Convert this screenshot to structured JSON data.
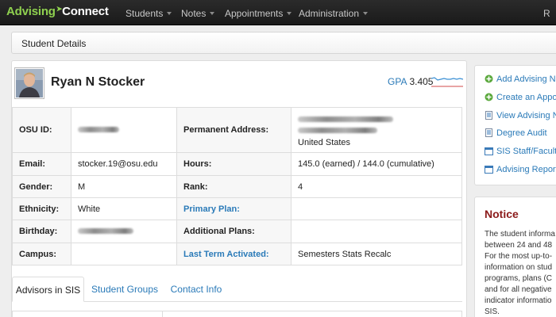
{
  "app": {
    "brand_part1": "Advising",
    "brand_part2": "Connect"
  },
  "nav": {
    "items": [
      {
        "label": "Students"
      },
      {
        "label": "Notes"
      },
      {
        "label": "Appointments"
      },
      {
        "label": "Administration"
      }
    ],
    "user_initial": "R"
  },
  "breadcrumb": {
    "title": "Student Details"
  },
  "student": {
    "name": "Ryan N Stocker",
    "gpa_label": "GPA",
    "gpa_value": "3.405"
  },
  "details": {
    "osu_id_label": "OSU ID:",
    "permanent_address_label": "Permanent Address:",
    "address_country": "United States",
    "email_label": "Email:",
    "email_value": "stocker.19@osu.edu",
    "hours_label": "Hours:",
    "hours_value": "145.0 (earned) / 144.0 (cumulative)",
    "gender_label": "Gender:",
    "gender_value": "M",
    "rank_label": "Rank:",
    "rank_value": "4",
    "ethnicity_label": "Ethnicity:",
    "ethnicity_value": "White",
    "primary_plan_label": "Primary Plan:",
    "birthday_label": "Birthday:",
    "additional_plans_label": "Additional Plans:",
    "campus_label": "Campus:",
    "last_term_label": "Last Term Activated:",
    "last_term_value": "Semesters Stats Recalc"
  },
  "tabs": [
    {
      "label": "Advisors in SIS"
    },
    {
      "label": "Student Groups"
    },
    {
      "label": "Contact Info"
    }
  ],
  "sidebar": {
    "actions": [
      {
        "label": "Add Advising N",
        "icon": "plus-circle-icon"
      },
      {
        "label": "Create an Appo",
        "icon": "plus-circle-icon"
      },
      {
        "label": "View Advising N",
        "icon": "document-icon"
      },
      {
        "label": "Degree Audit",
        "icon": "document-icon"
      },
      {
        "label": "SIS Staff/Faculty",
        "icon": "external-window-icon"
      },
      {
        "label": "Advising Report",
        "icon": "external-window-icon"
      }
    ],
    "notice": {
      "title": "Notice",
      "lines": [
        "The student informa",
        "between 24 and 48",
        "For the most up-to-",
        "information on stud",
        "programs, plans (C",
        "and for all negative",
        "indicator informatio",
        "SIS."
      ]
    }
  },
  "colors": {
    "brand_green": "#8fd14f",
    "link_blue": "#2a7ab8",
    "notice_red": "#8b1a1a",
    "gpa_line_blue": "#3a8fd4",
    "gpa_line_red": "#d04a4a"
  }
}
